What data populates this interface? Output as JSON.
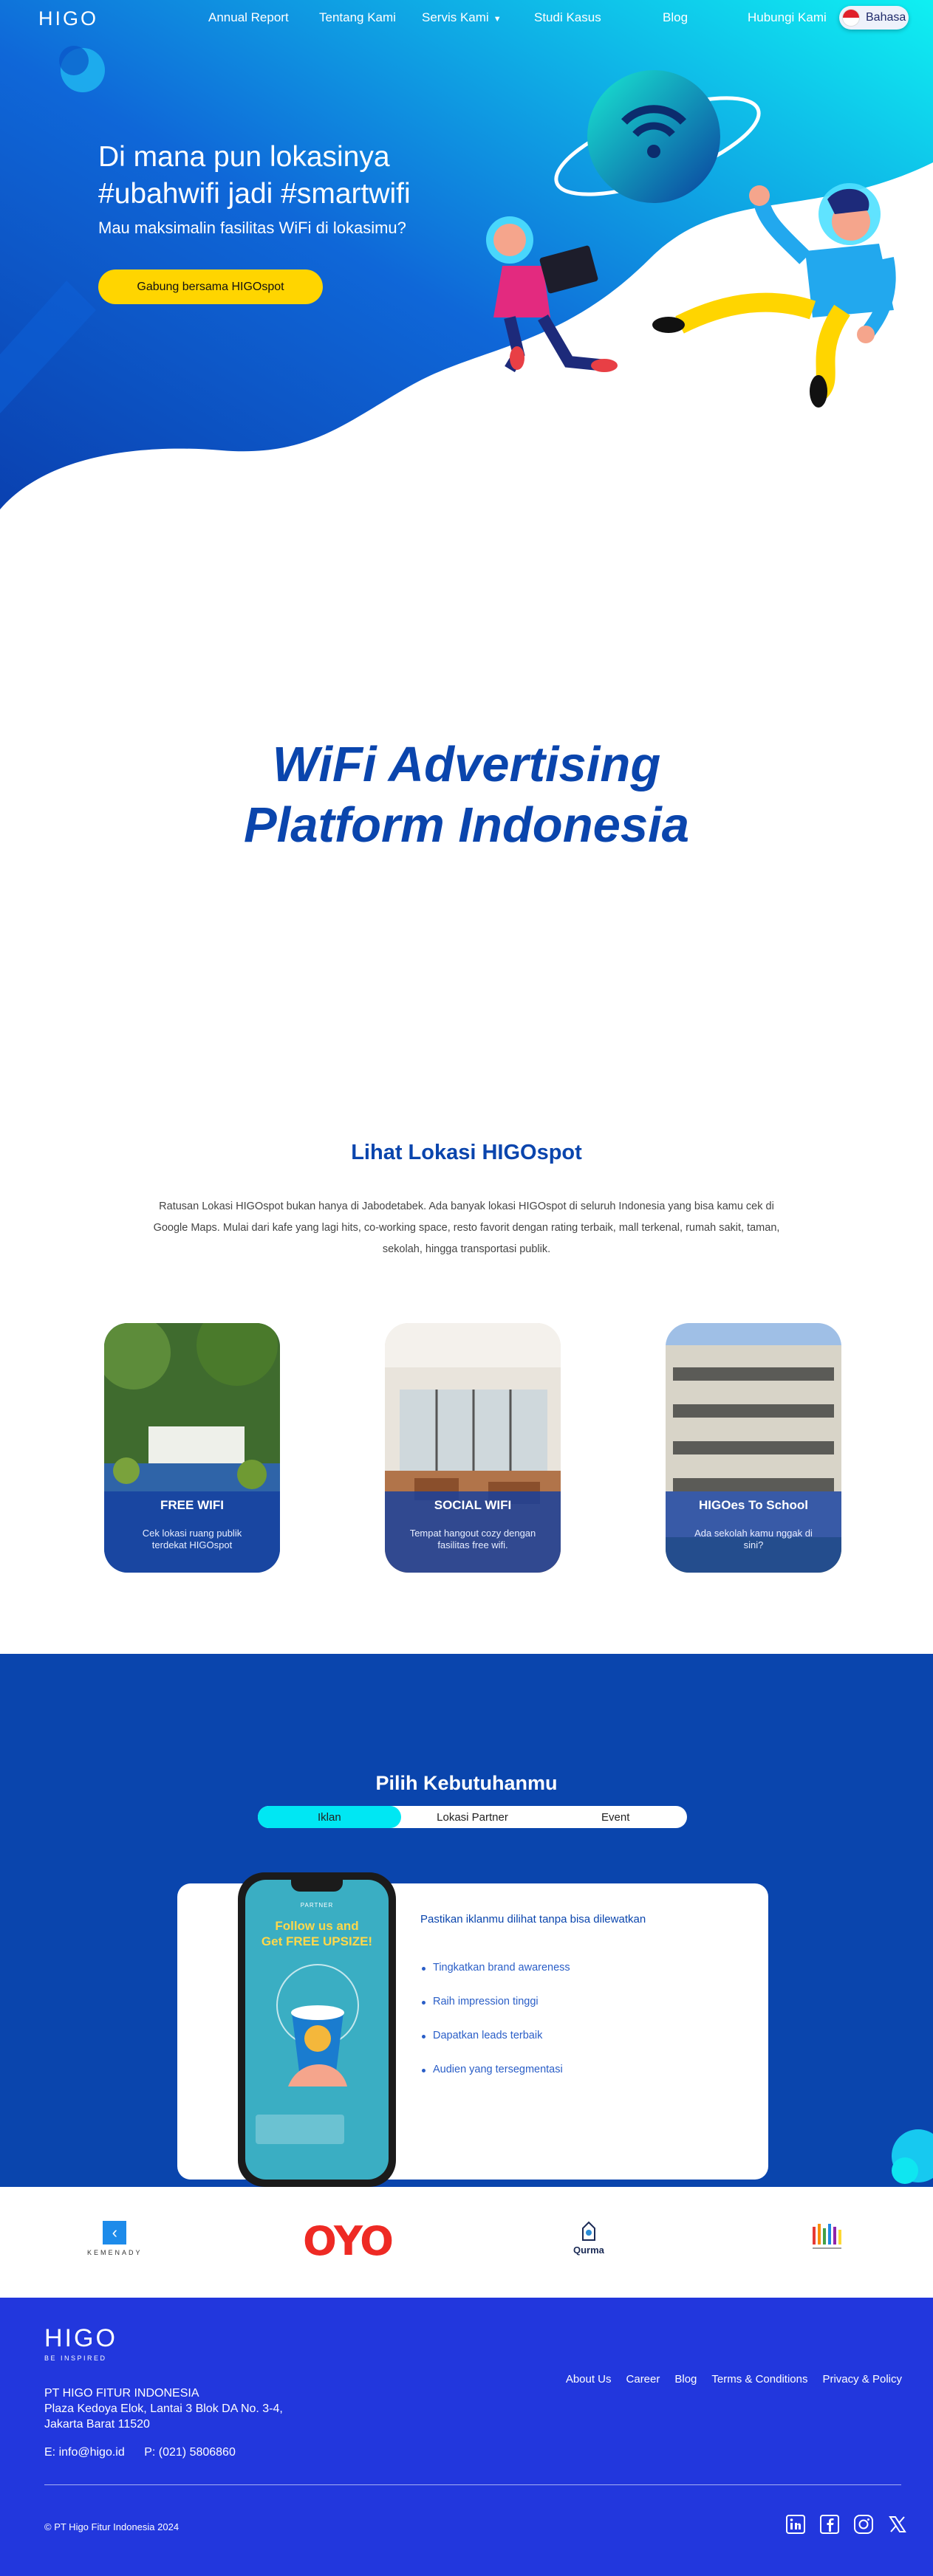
{
  "header": {
    "logo": "HIGO",
    "nav": [
      {
        "label": "Annual Report"
      },
      {
        "label": "Tentang Kami"
      },
      {
        "label": "Servis Kami"
      },
      {
        "label": "Studi Kasus"
      },
      {
        "label": "Blog"
      },
      {
        "label": "Hubungi Kami"
      }
    ],
    "language": "Bahasa"
  },
  "hero": {
    "title_line1": "Di mana pun lokasinya",
    "title_line2": "#ubahwifi jadi #smartwifi",
    "subtitle": "Mau maksimalin fasilitas WiFi di lokasimu?",
    "cta": "Gabung bersama HIGOspot"
  },
  "advertising": {
    "line1": "WiFi Advertising",
    "line2": "Platform Indonesia"
  },
  "locations": {
    "title": "Lihat Lokasi HIGOspot",
    "description": "Ratusan Lokasi HIGOspot bukan hanya di Jabodetabek. Ada banyak lokasi HIGOspot di seluruh Indonesia yang bisa kamu cek di Google Maps. Mulai dari kafe yang lagi hits, co-working space, resto favorit dengan rating terbaik, mall terkenal, rumah sakit, taman, sekolah, hingga transportasi publik.",
    "cards": [
      {
        "title": "FREE WIFI",
        "desc": "Cek lokasi ruang publik terdekat HIGOspot"
      },
      {
        "title": "SOCIAL WIFI",
        "desc": "Tempat hangout cozy dengan fasilitas free wifi."
      },
      {
        "title": "HIGOes To School",
        "desc": "Ada sekolah kamu nggak di sini?"
      }
    ]
  },
  "needs": {
    "title": "Pilih Kebutuhanmu",
    "tabs": [
      "Iklan",
      "Lokasi Partner",
      "Event"
    ],
    "active_tab": "Iklan",
    "phone_brand": "PARTNER",
    "phone_text_line1": "Follow us and",
    "phone_text_line2": "Get FREE UPSIZE!",
    "headline": "Pastikan iklanmu dilihat tanpa bisa dilewatkan",
    "items": [
      "Tingkatkan brand awareness",
      "Raih impression tinggi",
      "Dapatkan leads terbaik",
      "Audien yang tersegmentasi"
    ]
  },
  "partners": {
    "kemenady": "KEMENADY",
    "oyo": "OYO",
    "qurma": "Qurma"
  },
  "footer": {
    "logo": "HIGO",
    "tagline": "BE INSPIRED",
    "company_name": "PT HIGO FITUR INDONESIA",
    "address_line1": "Plaza Kedoya Elok, Lantai 3 Blok DA No. 3-4,",
    "address_line2": "Jakarta Barat 11520",
    "email": "E: info@higo.id",
    "phone": "P: (021) 5806860",
    "links": [
      "About Us",
      "Career",
      "Blog",
      "Terms & Conditions",
      "Privacy & Policy"
    ],
    "copyright": "© PT Higo Fitur Indonesia 2024"
  },
  "colors": {
    "brand_blue": "#0a45ad",
    "footer_blue": "#2237dd",
    "accent_yellow": "#ffd500",
    "accent_cyan": "#00e7f3"
  }
}
